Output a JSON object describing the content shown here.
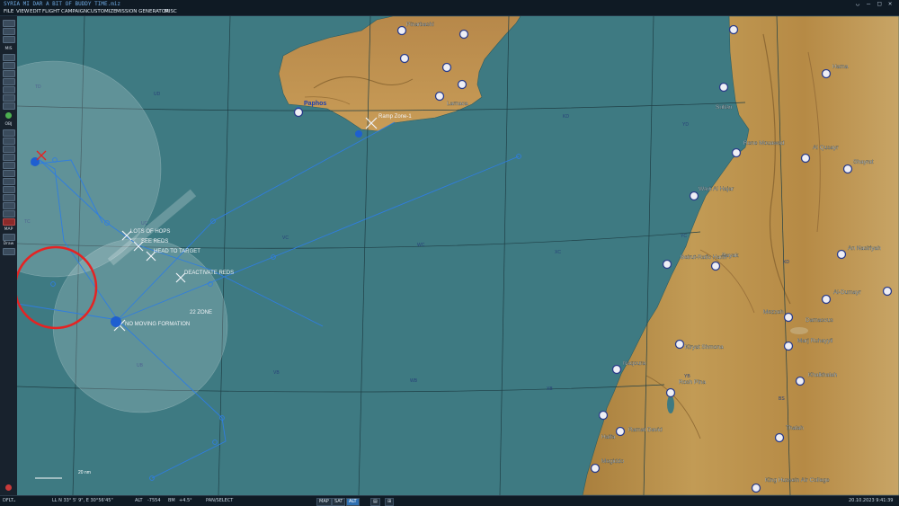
{
  "window": {
    "title": "SYRIA MI DAR A BIT OF BUDDY TIME.miz"
  },
  "menu": [
    "FILE",
    "VIEW",
    "EDIT",
    "FLIGHT",
    "CAMPAIGN",
    "CUSTOMIZE",
    "MISSION GENERATOR",
    "MISC"
  ],
  "sidebar": {
    "mis_label": "MIS",
    "obj_label": "OBJ",
    "map_label": "MAP",
    "draw_label": "Draw"
  },
  "map": {
    "grid_labels": [
      "TD",
      "UD",
      "TC",
      "UC",
      "VC",
      "WC",
      "XC",
      "YC",
      "UB",
      "VB",
      "WB",
      "XB",
      "YB",
      "BS",
      "KD",
      "YD",
      "XD"
    ],
    "places": [
      "Pinarbashi",
      "Paphos",
      "Larnaca",
      "Sultan",
      "Hama",
      "Al Qusayr",
      "Shayrat",
      "An Nasiriyah",
      "Rayak",
      "Beirut-Rafic Hariri",
      "Mezzeh",
      "Damascus",
      "Al-Dumayr",
      "Khalkhalah",
      "Thalah",
      "Kiryat Shmona",
      "Rosh Pina",
      "Naqoura",
      "Haifa",
      "Ramat David",
      "Megiddo",
      "King Hussein Air College",
      "Rene Mouawad",
      "Wadi Al Hajar",
      "Marj Ruhayyil"
    ],
    "annotations": [
      "NO MOVING FORMATION",
      "LOTS OF HOPS",
      "SEE REDS",
      "HEAD TO TARGET",
      "DEACTIVATE REDS",
      "Ramp Zone-1",
      "22 ZONE"
    ],
    "scale_label": "20 nm"
  },
  "status": {
    "profile": "DFLT",
    "coords": "LL  N 33° 5' 9\",  E 30°56'45\"",
    "alt_label": "ALT",
    "alt_value": "-7554",
    "bm_label": "BM",
    "bm_value": "+4.5°",
    "mode": "PAN/SELECT",
    "btn_map": "MAP",
    "btn_sat": "SAT",
    "btn_alt": "ALT",
    "datetime": "20.10.2023 9:41:39"
  },
  "colors": {
    "sea": "#3e7a82",
    "route": "#2f7de0",
    "highlight": "#e52323"
  }
}
